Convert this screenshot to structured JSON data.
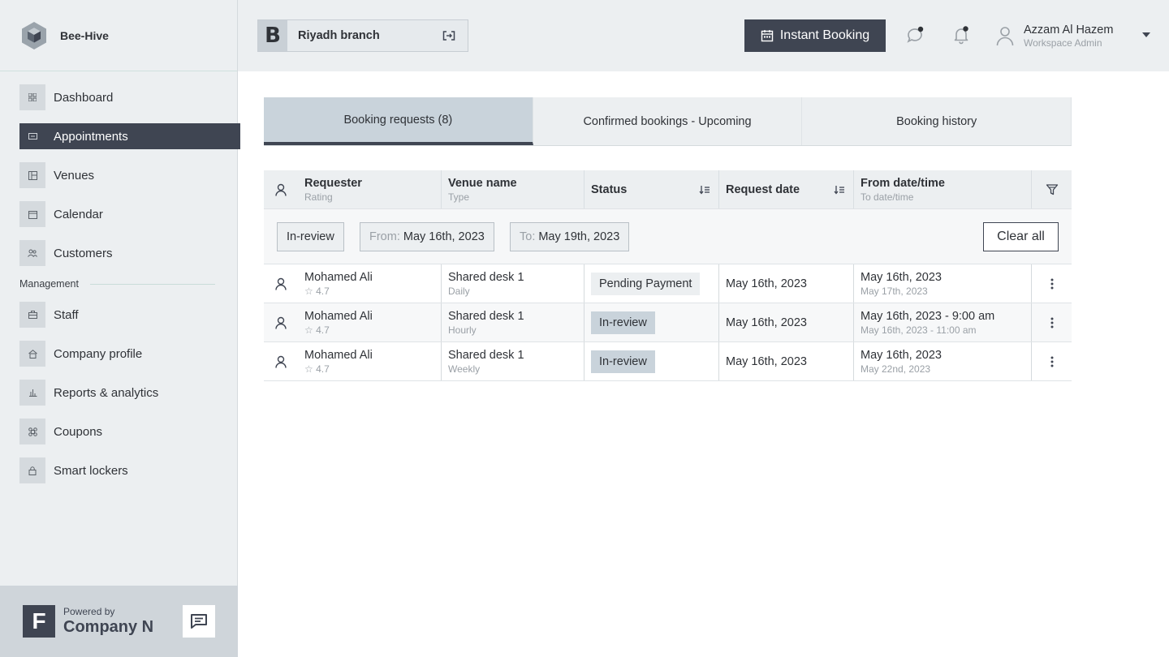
{
  "brand": {
    "name": "Bee-Hive"
  },
  "sidebar": {
    "items": [
      {
        "label": "Dashboard",
        "icon": "dashboard-icon",
        "active": false
      },
      {
        "label": "Appointments",
        "icon": "appointments-icon",
        "active": true
      },
      {
        "label": "Venues",
        "icon": "venues-icon",
        "active": false
      },
      {
        "label": "Calendar",
        "icon": "calendar-icon",
        "active": false
      },
      {
        "label": "Customers",
        "icon": "customers-icon",
        "active": false
      }
    ],
    "section_label": "Management",
    "management_items": [
      {
        "label": "Staff",
        "icon": "staff-icon"
      },
      {
        "label": "Company profile",
        "icon": "company-icon"
      },
      {
        "label": "Reports & analytics",
        "icon": "reports-icon"
      },
      {
        "label": "Coupons",
        "icon": "coupons-icon"
      },
      {
        "label": "Smart lockers",
        "icon": "lockers-icon"
      }
    ],
    "powered": {
      "logo_letter": "F",
      "by": "Powered by",
      "company": "Company N"
    }
  },
  "header": {
    "branch": {
      "badge": "B",
      "name": "Riyadh branch"
    },
    "instant_booking": "Instant Booking",
    "user": {
      "name": "Azzam Al Hazem",
      "role": "Workspace Admin"
    }
  },
  "tabs": [
    {
      "label": "Booking requests (8)",
      "active": true
    },
    {
      "label": "Confirmed bookings - Upcoming",
      "active": false
    },
    {
      "label": "Booking history",
      "active": false
    }
  ],
  "table": {
    "columns": {
      "requester": {
        "main": "Requester",
        "sub": "Rating"
      },
      "venue": {
        "main": "Venue name",
        "sub": "Type"
      },
      "status": {
        "main": "Status"
      },
      "request_date": {
        "main": "Request date"
      },
      "from": {
        "main": "From date/time",
        "sub": "To date/time"
      }
    },
    "filters": {
      "status": "In-review",
      "from_label": "From:",
      "from_value": "May 16th, 2023",
      "to_label": "To:",
      "to_value": "May 19th, 2023",
      "clear": "Clear all"
    },
    "rows": [
      {
        "name": "Mohamed Ali",
        "rating": "4.7",
        "venue": "Shared desk 1",
        "type": "Daily",
        "status": "Pending Payment",
        "status_kind": "pending",
        "request_date": "May 16th, 2023",
        "from": "May 16th, 2023",
        "to": "May 17th, 2023"
      },
      {
        "name": "Mohamed Ali",
        "rating": "4.7",
        "venue": "Shared desk 1",
        "type": "Hourly",
        "status": "In-review",
        "status_kind": "review",
        "request_date": "May 16th, 2023",
        "from": "May 16th, 2023 - 9:00 am",
        "to": "May 16th, 2023 - 11:00 am"
      },
      {
        "name": "Mohamed Ali",
        "rating": "4.7",
        "venue": "Shared desk 1",
        "type": "Weekly",
        "status": "In-review",
        "status_kind": "review",
        "request_date": "May 16th, 2023",
        "from": "May 16th, 2023",
        "to": "May 22nd, 2023"
      }
    ]
  },
  "colors": {
    "accent": "#3f4552",
    "sidebar_bg": "#eceff1",
    "badge_review": "#c9d3db"
  }
}
